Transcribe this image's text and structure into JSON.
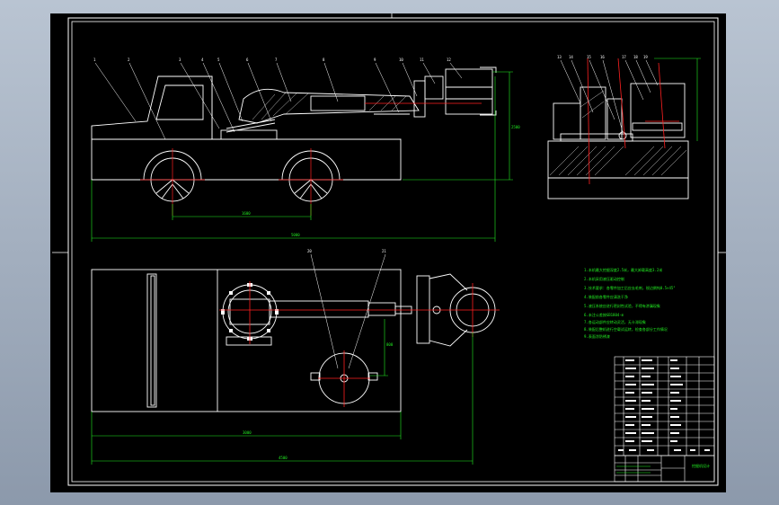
{
  "drawing": {
    "colors": {
      "background": "#000000",
      "outline": "#ffffff",
      "centerline": "#ff2020",
      "dimension": "#22ee22",
      "hatch": "#ffffff",
      "section": "#ff2020",
      "notes": "#22ee22",
      "frame": "#ffffff"
    },
    "balloons": [
      "1",
      "2",
      "3",
      "4",
      "5",
      "6",
      "7",
      "8",
      "9",
      "10",
      "11",
      "12"
    ],
    "side_balloons": [
      "13",
      "14",
      "15",
      "16",
      "17",
      "18",
      "19"
    ],
    "plan_balloons": [
      "20",
      "21"
    ],
    "dimensions": {
      "wheelbase": "1600",
      "overall_length": "5000",
      "height": "2500",
      "plan_width": "3000",
      "plan_length": "4500",
      "plan_offset": "800"
    },
    "notes": [
      "1.本机最大挖掘深度2.5米，最大卸载高度3.2米",
      "2.本机采用液压驱动控制",
      "3.技术要求：各零件加工后应去毛刺，锐边倒钝0.5×45°",
      "4.装配前各零件应清洗干净",
      "5.液压系统应进行密封性试验，不得有渗漏现象",
      "6.未注公差按GB1804-m",
      "7.各运动部件应转动灵活，无卡滞现象",
      "8.装配后整机进行空载试运转，检查各部分工作情况",
      "9.表面涂防锈漆"
    ],
    "title_block": {
      "title": "挖掘机设计"
    }
  }
}
